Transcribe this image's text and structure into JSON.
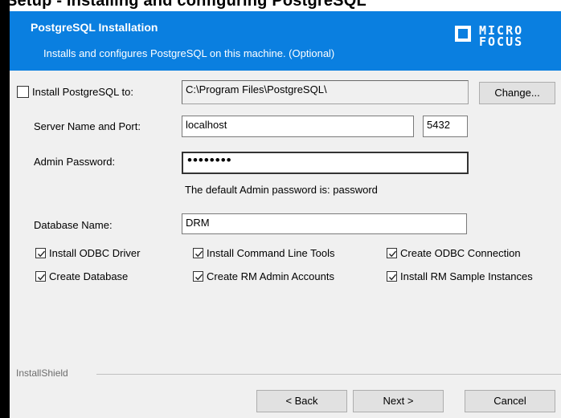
{
  "top_banner": "Setup - Installing and configuring PostgreSQL",
  "header": {
    "title": "PostgreSQL Installation",
    "subtitle": "Installs and configures PostgreSQL on this machine. (Optional)",
    "logo_line1": "MICRO",
    "logo_line2": "FOCUS",
    "bg_color": "#0a7fe0"
  },
  "form": {
    "install_label": "Install PostgreSQL to:",
    "install_checked": false,
    "install_path": "C:\\Program Files\\PostgreSQL\\",
    "change_button": "Change...",
    "server_label": "Server Name and Port:",
    "server_name": "localhost",
    "port": "5432",
    "admin_label": "Admin Password:",
    "admin_password": "••••••••",
    "default_note": "The default Admin password is: password",
    "db_label": "Database Name:",
    "db_name": "DRM"
  },
  "options": [
    {
      "label": "Install ODBC Driver",
      "checked": true
    },
    {
      "label": "Install Command Line Tools",
      "checked": true
    },
    {
      "label": "Create ODBC Connection",
      "checked": true
    },
    {
      "label": "Create Database",
      "checked": true
    },
    {
      "label": "Create RM Admin Accounts",
      "checked": true
    },
    {
      "label": "Install RM Sample Instances",
      "checked": true
    }
  ],
  "footer": {
    "brand": "InstallShield",
    "back": "< Back",
    "next": "Next >",
    "cancel": "Cancel"
  }
}
